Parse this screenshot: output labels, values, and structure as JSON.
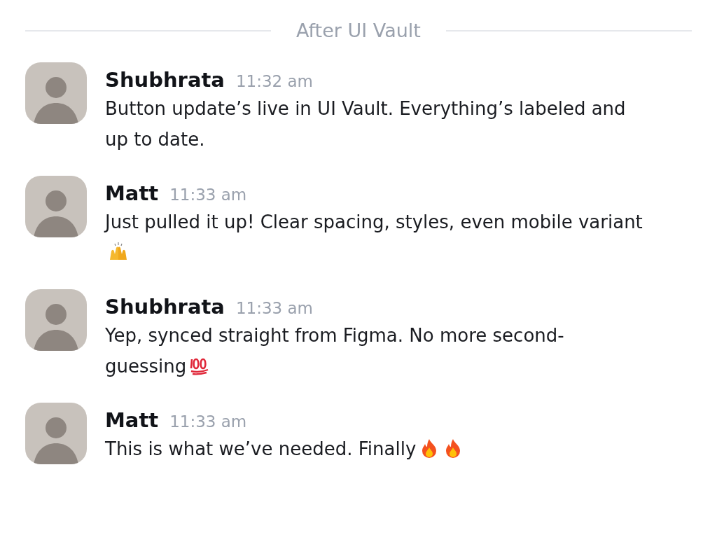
{
  "divider": {
    "label": "After UI Vault"
  },
  "messages": [
    {
      "author": "Shubhrata",
      "time": "11:32 am",
      "text": "Button update’s live in UI Vault. Everything’s labeled and up to date."
    },
    {
      "author": "Matt",
      "time": "11:33 am",
      "text": "Just pulled it up! Clear spacing, styles, even mobile variant",
      "emojis": [
        {
          "kind": "raised-hands"
        }
      ]
    },
    {
      "author": "Shubhrata",
      "time": "11:33 am",
      "text": "Yep, synced straight from Figma. No more second-guessing",
      "emojis": [
        {
          "kind": "hundred"
        }
      ]
    },
    {
      "author": "Matt",
      "time": "11:33 am",
      "text": "This is what we’ve needed. Finally",
      "emojis": [
        {
          "kind": "fire"
        },
        {
          "kind": "fire"
        }
      ]
    }
  ]
}
